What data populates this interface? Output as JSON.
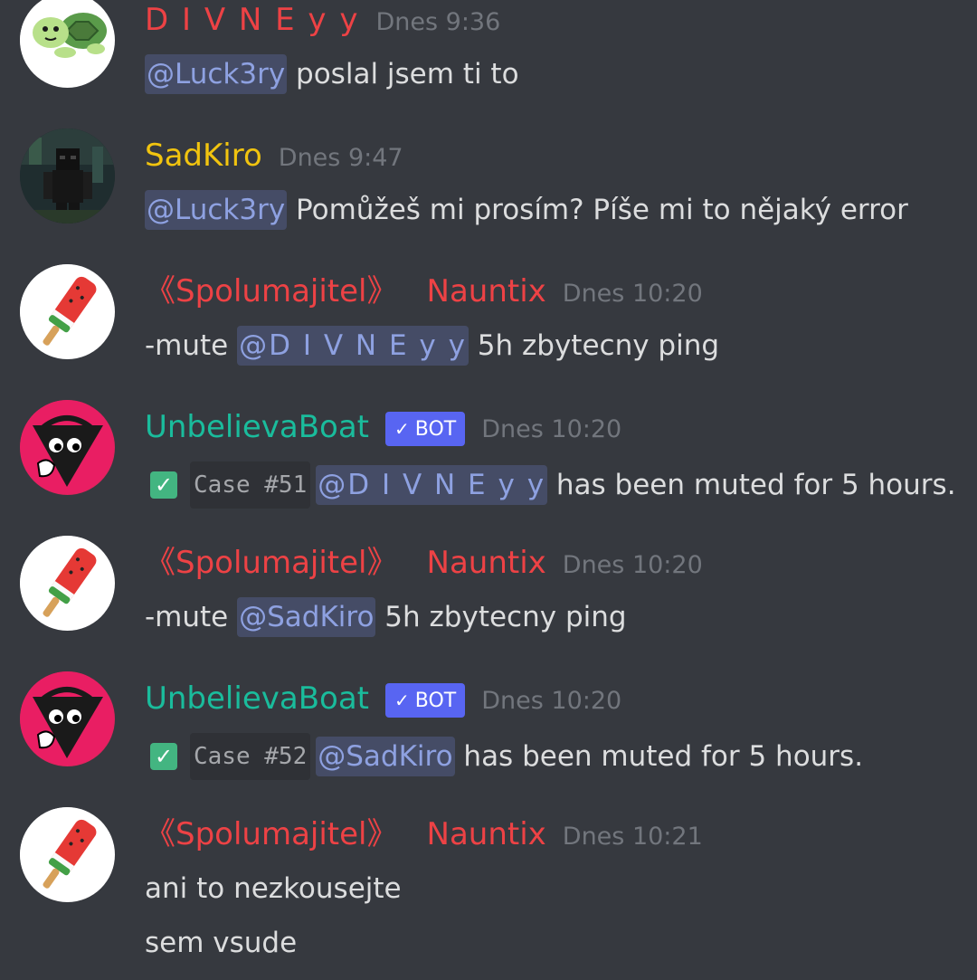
{
  "colors": {
    "background": "#36393f",
    "divneyy": "#ed4245",
    "sadkiro": "#f1c40f",
    "nauntix": "#ed4245",
    "unbelievaboat": "#1abc9c",
    "bot_badge": "#5865f2",
    "timestamp": "#72767d"
  },
  "messages": [
    {
      "avatar_icon": "turtle-avatar-icon",
      "username": "D I V N E y y",
      "timestamp": "Dnes 9:36",
      "mention": "@Luck3ry",
      "text": " poslal jsem ti to"
    },
    {
      "avatar_icon": "minecraft-skin-avatar-icon",
      "username": "SadKiro",
      "timestamp": "Dnes 9:47",
      "mention": "@Luck3ry",
      "text": " Pomůžeš mi prosím? Píše mi to nějaký error"
    },
    {
      "avatar_icon": "popsicle-avatar-icon",
      "prefix": "《Spolumajitel》",
      "username": "Nauntix",
      "timestamp": "Dnes 10:20",
      "before": "-mute ",
      "mention": "@D I V N E y y",
      "text": " 5h zbytecny ping"
    },
    {
      "avatar_icon": "unbelievaboat-avatar-icon",
      "username": "UnbelievaBoat",
      "badge": "BOT",
      "timestamp": "Dnes 10:20",
      "case": "Case #51",
      "mention": "@D I V N E y y",
      "text": " has been muted for 5 hours."
    },
    {
      "avatar_icon": "popsicle-avatar-icon",
      "prefix": "《Spolumajitel》",
      "username": "Nauntix",
      "timestamp": "Dnes 10:20",
      "before": "-mute ",
      "mention": "@SadKiro",
      "text": " 5h zbytecny ping"
    },
    {
      "avatar_icon": "unbelievaboat-avatar-icon",
      "username": "UnbelievaBoat",
      "badge": "BOT",
      "timestamp": "Dnes 10:20",
      "case": "Case #52",
      "mention": "@SadKiro",
      "text": " has been muted for 5 hours."
    },
    {
      "avatar_icon": "popsicle-avatar-icon",
      "prefix": "《Spolumajitel》",
      "username": "Nauntix",
      "timestamp": "Dnes 10:21",
      "lines": [
        "ani to nezkousejte",
        "sem vsude"
      ]
    }
  ]
}
